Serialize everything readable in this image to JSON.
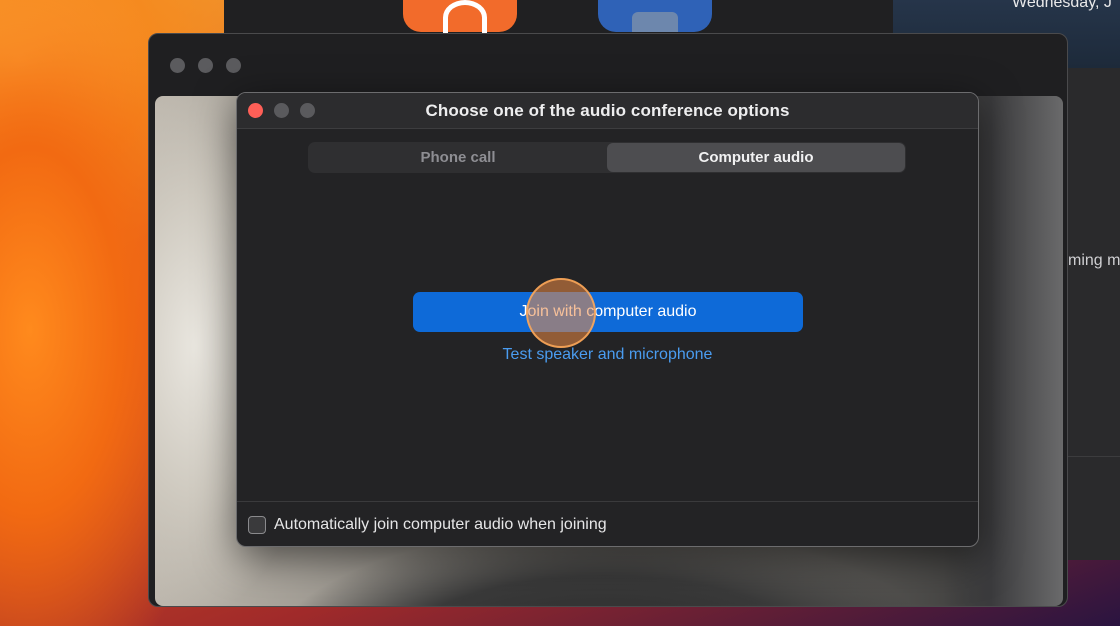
{
  "background": {
    "date_partial": "Wednesday, J",
    "upcoming_partial": "ming m"
  },
  "dialog": {
    "title": "Choose one of the audio conference options",
    "tabs": [
      {
        "label": "Phone call",
        "active": false
      },
      {
        "label": "Computer audio",
        "active": true
      }
    ],
    "join_button_label": "Join with computer audio",
    "test_link_label": "Test speaker and microphone",
    "auto_join_label": "Automatically join computer audio when joining",
    "auto_join_checked": false
  },
  "colors": {
    "accent": "#0e6ad8",
    "link": "#4a9cf0",
    "close": "#fe5f57"
  }
}
